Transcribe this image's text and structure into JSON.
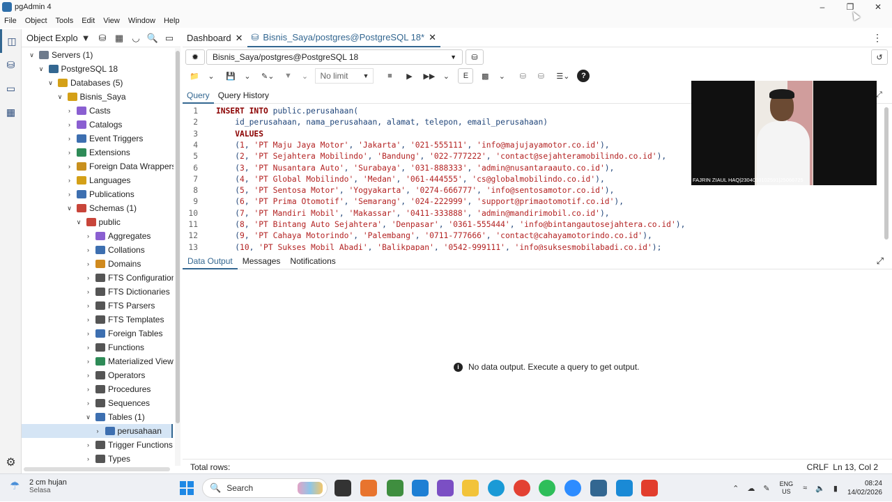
{
  "window": {
    "title": "pgAdmin 4"
  },
  "menu": [
    "File",
    "Object",
    "Tools",
    "Edit",
    "View",
    "Window",
    "Help"
  ],
  "object_explorer": {
    "title": "Object Explorer",
    "tree": [
      {
        "label": "Servers (1)",
        "depth": 0,
        "expanded": true,
        "icon": "servers-icon"
      },
      {
        "label": "PostgreSQL 18",
        "depth": 1,
        "expanded": true,
        "icon": "postgres-icon"
      },
      {
        "label": "Databases (5)",
        "depth": 2,
        "expanded": true,
        "icon": "databases-icon"
      },
      {
        "label": "Bisnis_Saya",
        "depth": 3,
        "expanded": true,
        "icon": "database-icon"
      },
      {
        "label": "Casts",
        "depth": 4,
        "expanded": false,
        "icon": "casts-icon"
      },
      {
        "label": "Catalogs",
        "depth": 4,
        "expanded": false,
        "icon": "catalogs-icon"
      },
      {
        "label": "Event Triggers",
        "depth": 4,
        "expanded": false,
        "icon": "event-triggers-icon"
      },
      {
        "label": "Extensions",
        "depth": 4,
        "expanded": false,
        "icon": "extensions-icon"
      },
      {
        "label": "Foreign Data Wrappers",
        "depth": 4,
        "expanded": false,
        "icon": "fdw-icon"
      },
      {
        "label": "Languages",
        "depth": 4,
        "expanded": false,
        "icon": "languages-icon"
      },
      {
        "label": "Publications",
        "depth": 4,
        "expanded": false,
        "icon": "publications-icon"
      },
      {
        "label": "Schemas (1)",
        "depth": 4,
        "expanded": true,
        "icon": "schemas-icon"
      },
      {
        "label": "public",
        "depth": 5,
        "expanded": true,
        "icon": "schema-icon"
      },
      {
        "label": "Aggregates",
        "depth": 6,
        "expanded": false,
        "icon": "aggregates-icon"
      },
      {
        "label": "Collations",
        "depth": 6,
        "expanded": false,
        "icon": "collations-icon"
      },
      {
        "label": "Domains",
        "depth": 6,
        "expanded": false,
        "icon": "domains-icon"
      },
      {
        "label": "FTS Configurations",
        "depth": 6,
        "expanded": false,
        "icon": "fts-config-icon"
      },
      {
        "label": "FTS Dictionaries",
        "depth": 6,
        "expanded": false,
        "icon": "fts-dict-icon"
      },
      {
        "label": "FTS Parsers",
        "depth": 6,
        "expanded": false,
        "icon": "fts-parser-icon"
      },
      {
        "label": "FTS Templates",
        "depth": 6,
        "expanded": false,
        "icon": "fts-template-icon"
      },
      {
        "label": "Foreign Tables",
        "depth": 6,
        "expanded": false,
        "icon": "foreign-tables-icon"
      },
      {
        "label": "Functions",
        "depth": 6,
        "expanded": false,
        "icon": "functions-icon"
      },
      {
        "label": "Materialized Views",
        "depth": 6,
        "expanded": false,
        "icon": "mviews-icon"
      },
      {
        "label": "Operators",
        "depth": 6,
        "expanded": false,
        "icon": "operators-icon"
      },
      {
        "label": "Procedures",
        "depth": 6,
        "expanded": false,
        "icon": "procedures-icon"
      },
      {
        "label": "Sequences",
        "depth": 6,
        "expanded": false,
        "icon": "sequences-icon"
      },
      {
        "label": "Tables (1)",
        "depth": 6,
        "expanded": true,
        "icon": "tables-icon"
      },
      {
        "label": "perusahaan",
        "depth": 7,
        "expanded": false,
        "icon": "table-icon",
        "selected": true
      },
      {
        "label": "Trigger Functions",
        "depth": 6,
        "expanded": false,
        "icon": "trigger-functions-icon"
      },
      {
        "label": "Types",
        "depth": 6,
        "expanded": false,
        "icon": "types-icon"
      }
    ]
  },
  "tabs": [
    {
      "label": "Dashboard",
      "active": false
    },
    {
      "label": "Bisnis_Saya/postgres@PostgreSQL 18*",
      "active": true
    }
  ],
  "connection": {
    "value": "Bisnis_Saya/postgres@PostgreSQL 18"
  },
  "toolbar": {
    "limit": "No limit"
  },
  "query_tabs": [
    {
      "label": "Query",
      "active": true
    },
    {
      "label": "Query History",
      "active": false
    }
  ],
  "editor": {
    "lines": [
      "INSERT INTO public.perusahaan(",
      "    id_perusahaan, nama_perusahaan, alamat, telepon, email_perusahaan)",
      "    VALUES",
      "    (1, 'PT Maju Jaya Motor', 'Jakarta', '021-555111', 'info@majujayamotor.co.id'),",
      "    (2, 'PT Sejahtera Mobilindo', 'Bandung', '022-777222', 'contact@sejahteramobilindo.co.id'),",
      "    (3, 'PT Nusantara Auto', 'Surabaya', '031-888333', 'admin@nusantaraauto.co.id'),",
      "    (4, 'PT Global Mobilindo', 'Medan', '061-444555', 'cs@globalmobilindo.co.id'),",
      "    (5, 'PT Sentosa Motor', 'Yogyakarta', '0274-666777', 'info@sentosamotor.co.id'),",
      "    (6, 'PT Prima Otomotif', 'Semarang', '024-222999', 'support@primaotomotif.co.id'),",
      "    (7, 'PT Mandiri Mobil', 'Makassar', '0411-333888', 'admin@mandirimobil.co.id'),",
      "    (8, 'PT Bintang Auto Sejahtera', 'Denpasar', '0361-555444', 'info@bintangautosejahtera.co.id'),",
      "    (9, 'PT Cahaya Motorindo', 'Palembang', '0711-777666', 'contact@cahayamotorindo.co.id'),",
      "    (10, 'PT Sukses Mobil Abadi', 'Balikpapan', '0542-999111', 'info@suksesmobilabadi.co.id');"
    ]
  },
  "webcam": {
    "label": "FAJRIN ZIAUL HAQ|2304010102591|25066725"
  },
  "result_tabs": [
    {
      "label": "Data Output",
      "active": true
    },
    {
      "label": "Messages",
      "active": false
    },
    {
      "label": "Notifications",
      "active": false
    }
  ],
  "result": {
    "message": "No data output. Execute a query to get output."
  },
  "status": {
    "total_rows": "Total rows:",
    "eol": "CRLF",
    "position": "Ln 13, Col 2"
  },
  "taskbar": {
    "weather_temp": "2 cm hujan",
    "weather_day": "Selasa",
    "search": "Search",
    "lang1": "ENG",
    "lang2": "US",
    "time": "08:24",
    "date": "14/02/2026"
  }
}
